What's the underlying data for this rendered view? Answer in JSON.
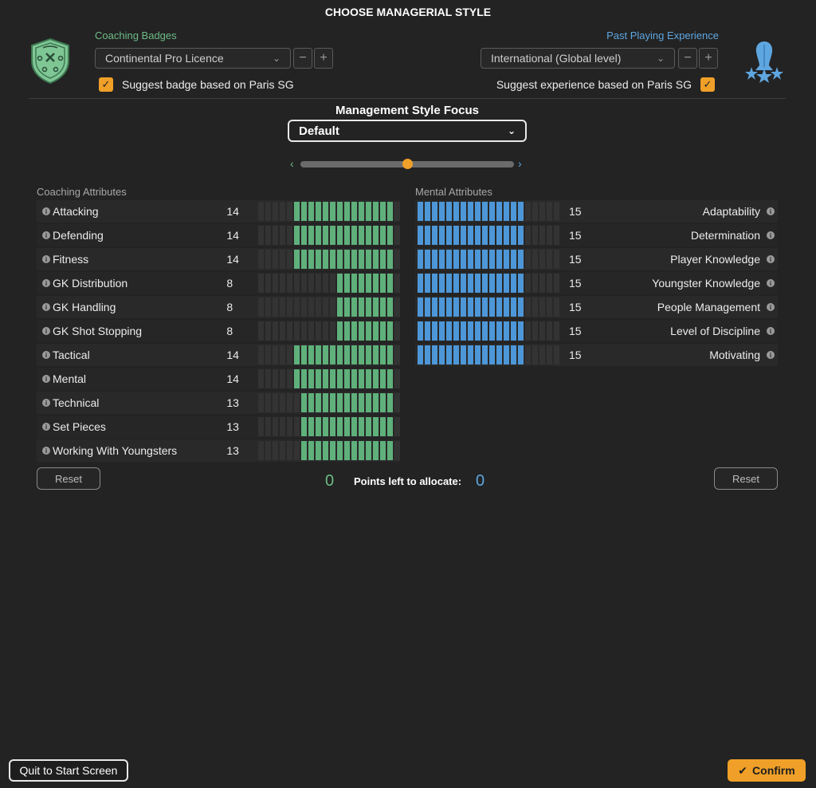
{
  "title": "CHOOSE MANAGERIAL STYLE",
  "coaching_badges": {
    "label": "Coaching Badges",
    "selected": "Continental Pro Licence",
    "minus": "−",
    "plus": "+",
    "suggest_label": "Suggest badge based on Paris SG",
    "suggest_checked": true,
    "icon": "badge-shield-icon"
  },
  "past_playing": {
    "label": "Past Playing Experience",
    "selected": "International (Global level)",
    "minus": "−",
    "plus": "+",
    "suggest_label": "Suggest experience based on Paris SG",
    "suggest_checked": true,
    "icon": "player-stars-icon"
  },
  "focus": {
    "title": "Management Style Focus",
    "selected": "Default",
    "slider_value": 0.5
  },
  "coaching": {
    "header": "Coaching Attributes",
    "max": 20,
    "items": [
      {
        "name": "Attacking",
        "value": 14
      },
      {
        "name": "Defending",
        "value": 14
      },
      {
        "name": "Fitness",
        "value": 14
      },
      {
        "name": "GK Distribution",
        "value": 8
      },
      {
        "name": "GK Handling",
        "value": 8
      },
      {
        "name": "GK Shot Stopping",
        "value": 8
      },
      {
        "name": "Tactical",
        "value": 14
      },
      {
        "name": "Mental",
        "value": 14
      },
      {
        "name": "Technical",
        "value": 13
      },
      {
        "name": "Set Pieces",
        "value": 13
      },
      {
        "name": "Working With Youngsters",
        "value": 13
      }
    ],
    "reset_label": "Reset",
    "points_left": "0"
  },
  "mental": {
    "header": "Mental Attributes",
    "max": 20,
    "items": [
      {
        "name": "Adaptability",
        "value": 15
      },
      {
        "name": "Determination",
        "value": 15
      },
      {
        "name": "Player Knowledge",
        "value": 15
      },
      {
        "name": "Youngster Knowledge",
        "value": 15
      },
      {
        "name": "People Management",
        "value": 15
      },
      {
        "name": "Level of Discipline",
        "value": 15
      },
      {
        "name": "Motivating",
        "value": 15
      }
    ],
    "reset_label": "Reset",
    "points_left": "0"
  },
  "points_label": "Points left to allocate:",
  "footer": {
    "quit_label": "Quit to Start Screen",
    "confirm_label": "Confirm"
  },
  "colors": {
    "accent": "#f0a028",
    "green": "#5fb07b",
    "blue": "#4d97d8"
  }
}
